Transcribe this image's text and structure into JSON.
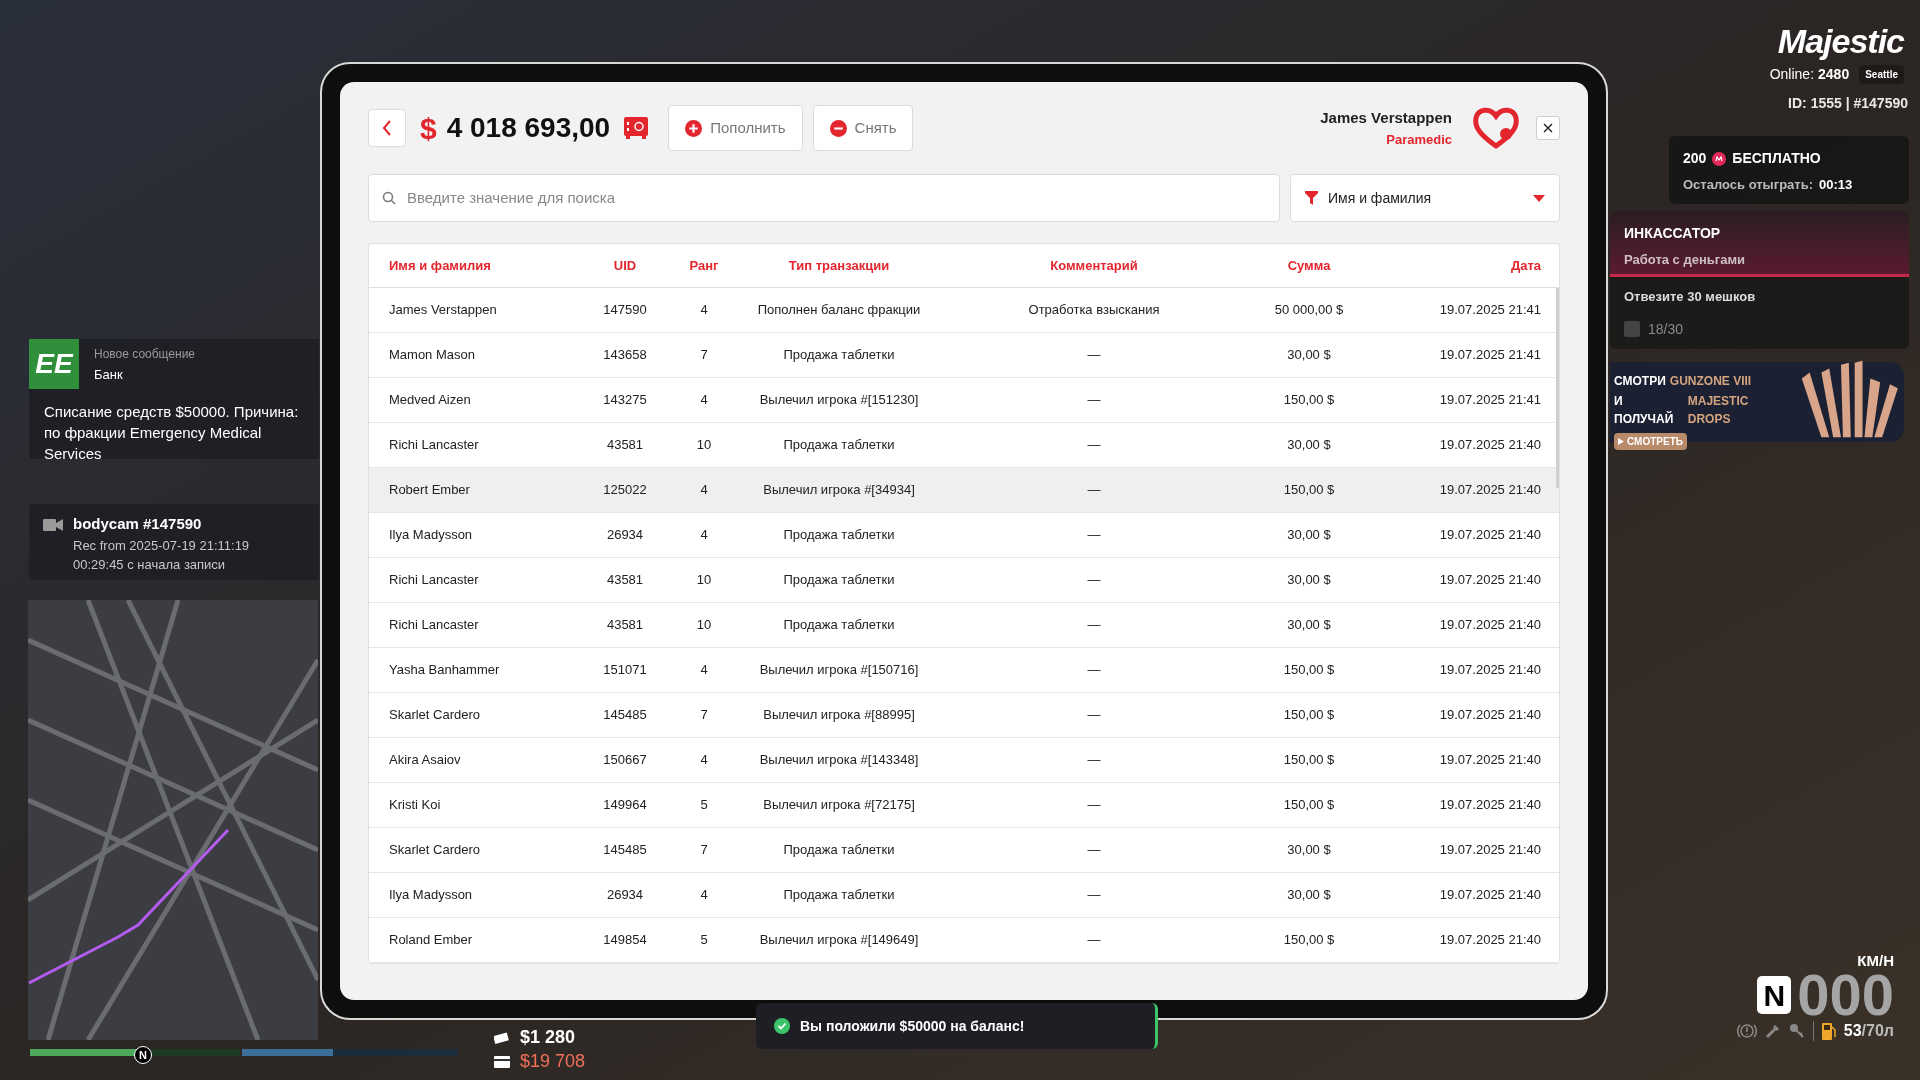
{
  "notification": {
    "app_logo": "EE",
    "title": "Новое сообщение",
    "sender": "Банк",
    "message": "Списание средств $50000. Причина: по фракции Emergency Medical Services"
  },
  "bodycam": {
    "title": "bodycam #147590",
    "recorded": "Rec from 2025-07-19 21:11:19",
    "elapsed": "00:29:45 с начала записи"
  },
  "minimap": {
    "compass": "N",
    "health": {
      "level": 0.52
    },
    "armor": {
      "level": 0.42
    }
  },
  "wallet": {
    "cash": "$1 280",
    "bank": "$19 708"
  },
  "toast": {
    "text": "Вы положили $50000 на баланс!"
  },
  "server": {
    "logo": "Majestic",
    "online_label": "Online:",
    "online": "2480",
    "city": "Seattle",
    "id": "ID: 1555 | #147590"
  },
  "bonus": {
    "amount": "200",
    "label": "БЕСПЛАТНО",
    "remaining_label": "Осталось отыграть:",
    "remaining": "00:13"
  },
  "job": {
    "title": "ИНКАССАТОР",
    "subtitle": "Работа с деньгами",
    "task": "Отвезите 30 мешков",
    "checked": false,
    "progress": "18/30"
  },
  "promo": {
    "line1_a": "СМОТРИ",
    "line1_b": "GUNZONE VIII",
    "line2_a": "И ПОЛУЧАЙ",
    "line2_b": "MAJESTIC DROPS",
    "button": "СМОТРЕТЬ"
  },
  "speedometer": {
    "unit": "КМ/Н",
    "gear": "N",
    "speed": "000",
    "fuel": "53",
    "fuel_max": "/70л"
  },
  "tablet": {
    "currency": "$",
    "balance": "4 018 693,00",
    "deposit": "Пополнить",
    "withdraw": "Снять",
    "user": "James Verstappen",
    "role": "Paramedic",
    "search": {
      "placeholder": "Введите значение для поиска"
    },
    "filter": "Имя и фамилия",
    "table": {
      "columns": [
        "Имя и фамилия",
        "UID",
        "Ранг",
        "Тип транзакции",
        "Комментарий",
        "Сумма",
        "Дата"
      ],
      "rows": [
        {
          "name": "James Verstappen",
          "uid": "147590",
          "rank": "4",
          "type": "Пополнен баланс фракции",
          "comment": "Отработка взыскания",
          "sum": "50 000,00 $",
          "date": "19.07.2025 21:41",
          "selected": false
        },
        {
          "name": "Mamon Mason",
          "uid": "143658",
          "rank": "7",
          "type": "Продажа таблетки",
          "comment": "—",
          "sum": "30,00 $",
          "date": "19.07.2025 21:41",
          "selected": false
        },
        {
          "name": "Medved Aizen",
          "uid": "143275",
          "rank": "4",
          "type": "Вылечил игрока #[151230]",
          "comment": "—",
          "sum": "150,00 $",
          "date": "19.07.2025 21:41",
          "selected": false
        },
        {
          "name": "Richi Lancaster",
          "uid": "43581",
          "rank": "10",
          "type": "Продажа таблетки",
          "comment": "—",
          "sum": "30,00 $",
          "date": "19.07.2025 21:40",
          "selected": false
        },
        {
          "name": "Robert Ember",
          "uid": "125022",
          "rank": "4",
          "type": "Вылечил игрока #[34934]",
          "comment": "—",
          "sum": "150,00 $",
          "date": "19.07.2025 21:40",
          "selected": true
        },
        {
          "name": "Ilya Madysson",
          "uid": "26934",
          "rank": "4",
          "type": "Продажа таблетки",
          "comment": "—",
          "sum": "30,00 $",
          "date": "19.07.2025 21:40",
          "selected": false
        },
        {
          "name": "Richi Lancaster",
          "uid": "43581",
          "rank": "10",
          "type": "Продажа таблетки",
          "comment": "—",
          "sum": "30,00 $",
          "date": "19.07.2025 21:40",
          "selected": false
        },
        {
          "name": "Richi Lancaster",
          "uid": "43581",
          "rank": "10",
          "type": "Продажа таблетки",
          "comment": "—",
          "sum": "30,00 $",
          "date": "19.07.2025 21:40",
          "selected": false
        },
        {
          "name": "Yasha Banhammer",
          "uid": "151071",
          "rank": "4",
          "type": "Вылечил игрока #[150716]",
          "comment": "—",
          "sum": "150,00 $",
          "date": "19.07.2025 21:40",
          "selected": false
        },
        {
          "name": "Skarlet Cardero",
          "uid": "145485",
          "rank": "7",
          "type": "Вылечил игрока #[88995]",
          "comment": "—",
          "sum": "150,00 $",
          "date": "19.07.2025 21:40",
          "selected": false
        },
        {
          "name": "Akira Asaiov",
          "uid": "150667",
          "rank": "4",
          "type": "Вылечил игрока #[143348]",
          "comment": "—",
          "sum": "150,00 $",
          "date": "19.07.2025 21:40",
          "selected": false
        },
        {
          "name": "Kristi Koi",
          "uid": "149964",
          "rank": "5",
          "type": "Вылечил игрока #[72175]",
          "comment": "—",
          "sum": "150,00 $",
          "date": "19.07.2025 21:40",
          "selected": false
        },
        {
          "name": "Skarlet Cardero",
          "uid": "145485",
          "rank": "7",
          "type": "Продажа таблетки",
          "comment": "—",
          "sum": "30,00 $",
          "date": "19.07.2025 21:40",
          "selected": false
        },
        {
          "name": "Ilya Madysson",
          "uid": "26934",
          "rank": "4",
          "type": "Продажа таблетки",
          "comment": "—",
          "sum": "30,00 $",
          "date": "19.07.2025 21:40",
          "selected": false
        },
        {
          "name": "Roland Ember",
          "uid": "149854",
          "rank": "5",
          "type": "Вылечил игрока #[149649]",
          "comment": "—",
          "sum": "150,00 $",
          "date": "19.07.2025 21:40",
          "selected": false
        }
      ]
    }
  }
}
